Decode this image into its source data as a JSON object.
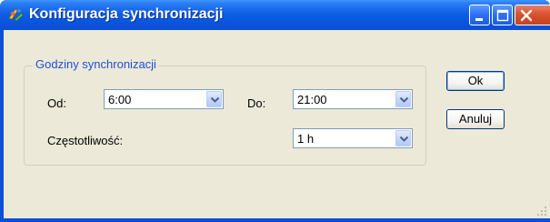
{
  "window": {
    "title": "Konfiguracja synchronizacji",
    "icons": [
      "app-icon",
      "minimize-icon",
      "maximize-icon",
      "close-icon"
    ]
  },
  "group": {
    "legend": "Godziny synchronizacji",
    "from_label": "Od:",
    "from_value": "6:00",
    "to_label": "Do:",
    "to_value": "21:00",
    "frequency_label": "Częstotliwość:",
    "frequency_value": "1 h"
  },
  "buttons": {
    "ok": "Ok",
    "cancel": "Anuluj"
  },
  "colors": {
    "title_bar": "#0a56df",
    "legend_text": "#1f50d8",
    "client_bg": "#ece9d8",
    "close_button": "#d8532e"
  }
}
